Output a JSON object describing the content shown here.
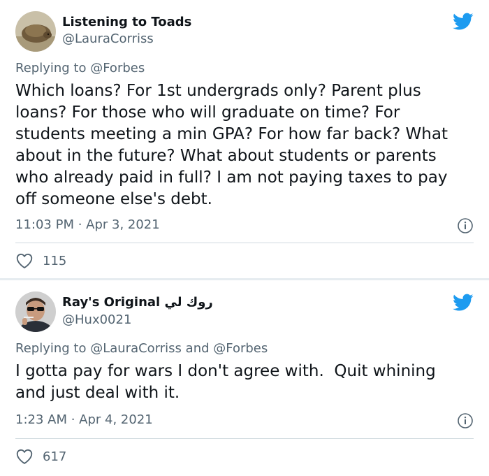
{
  "tweets": [
    {
      "display_name": "Listening to Toads",
      "handle": "@LauraCorriss",
      "replying_prefix": "Replying to",
      "replying_mentions": "@Forbes",
      "text": "Which loans? For 1st undergrads only? Parent plus\nloans? For those who will graduate on time? For\nstudents meeting a min GPA? For how far back? What\nabout in the future? What about students or parents\nwho already paid in full? I am not paying taxes to pay\noff someone else's debt.",
      "timestamp": "11:03 PM · Apr 3, 2021",
      "likes": "115"
    },
    {
      "display_name": "Ray's Original روك لي",
      "handle": "@Hux0021",
      "replying_prefix": "Replying to",
      "replying_mentions": "@LauraCorriss and @Forbes",
      "text": "I gotta pay for wars I don't agree with.  Quit whining\nand just deal with it.",
      "timestamp": "1:23 AM · Apr 4, 2021",
      "likes": "617"
    }
  ],
  "colors": {
    "twitter_blue": "#1d9bf0",
    "secondary_text": "#536471",
    "primary_text": "#0f1419"
  },
  "icons": [
    "twitter-bird-icon",
    "info-icon",
    "heart-icon"
  ]
}
